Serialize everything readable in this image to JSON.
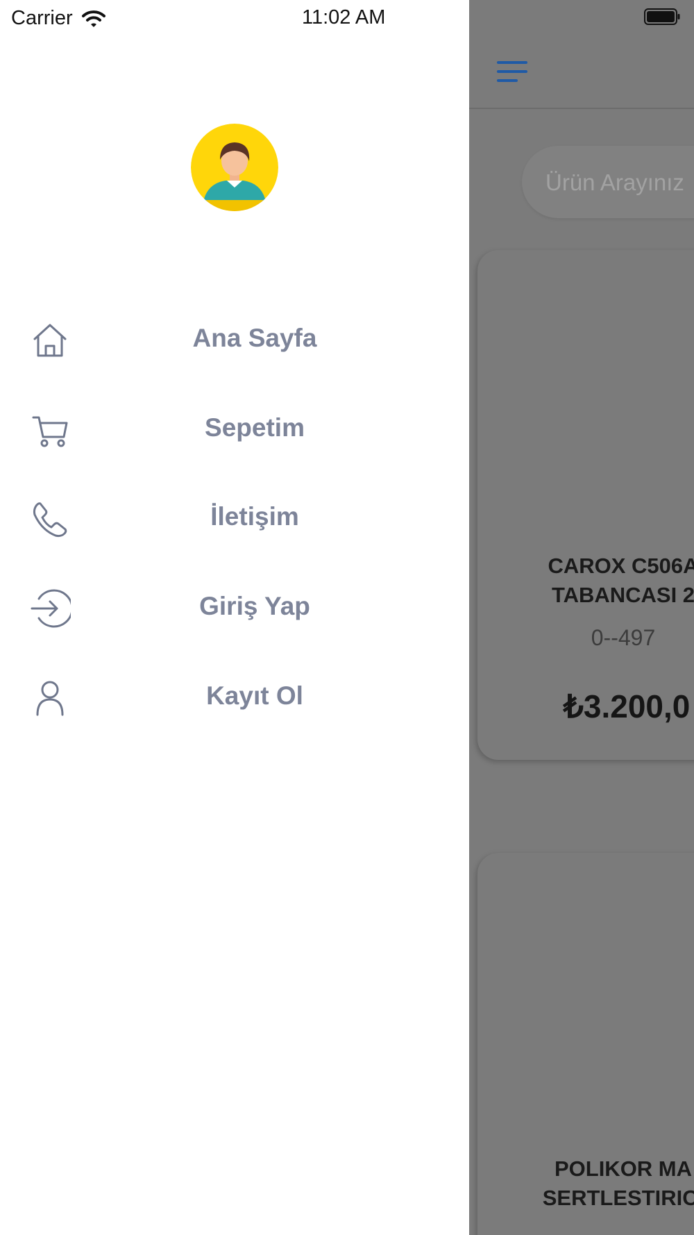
{
  "status_bar": {
    "carrier": "Carrier",
    "time": "11:02 AM"
  },
  "drawer": {
    "menu": [
      {
        "label": "Ana Sayfa",
        "icon": "home-icon"
      },
      {
        "label": "Sepetim",
        "icon": "cart-icon"
      },
      {
        "label": "İletişim",
        "icon": "phone-icon"
      },
      {
        "label": "Giriş Yap",
        "icon": "login-icon"
      },
      {
        "label": "Kayıt Ol",
        "icon": "user-icon"
      }
    ]
  },
  "app": {
    "search": {
      "placeholder": "Ürün Arayınız"
    },
    "products": [
      {
        "title_line1": "CAROX C506A",
        "title_line2": "TABANCASI 2",
        "code": "0--497",
        "price": "₺3.200,0"
      },
      {
        "title_line1": "POLIKOR MA",
        "title_line2": "SERTLESTIRICI"
      }
    ]
  },
  "colors": {
    "menu_text": "#7d8499",
    "icon_stroke": "#6f778c",
    "accent": "#1f5aa6",
    "avatar_bg": "#ffd60a",
    "overlay": "#7b7b7b"
  }
}
